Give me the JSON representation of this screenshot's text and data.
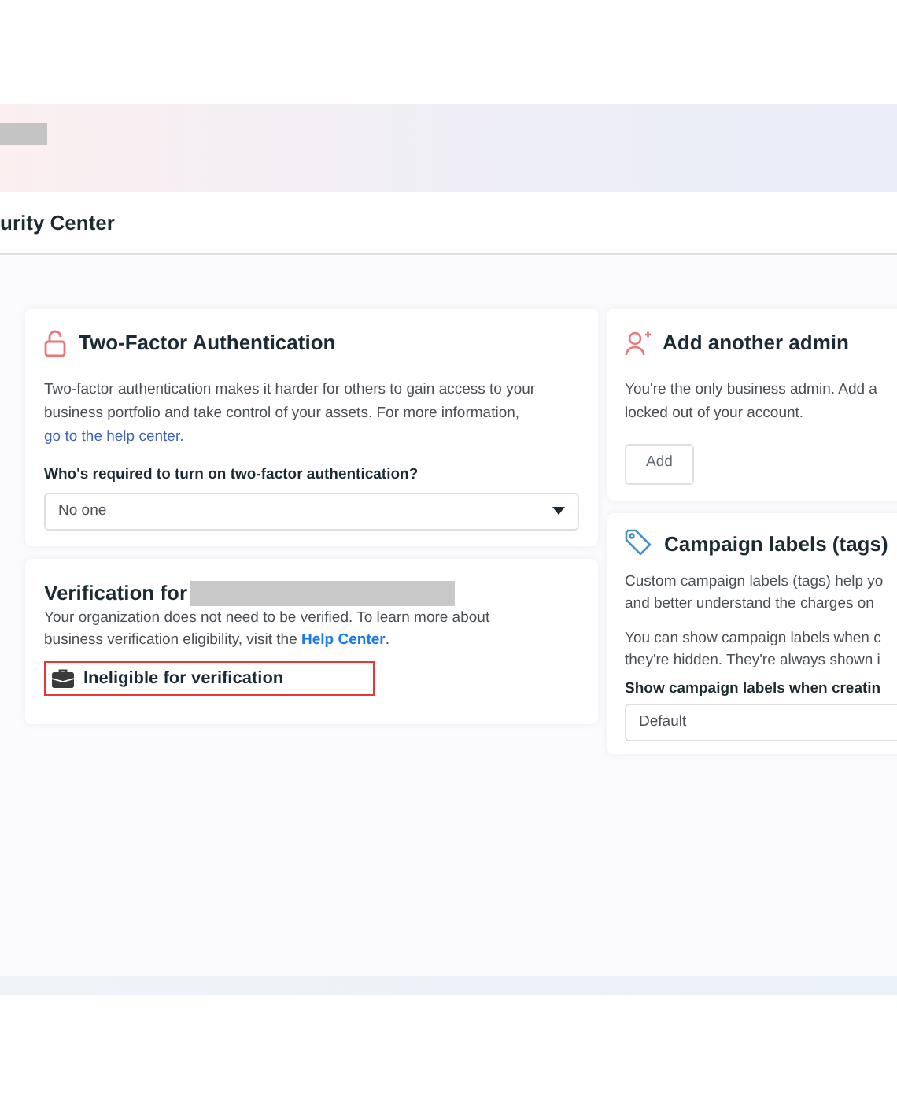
{
  "header": {
    "title": "urity Center"
  },
  "two_factor": {
    "title": "Two-Factor Authentication",
    "description": "Two-factor authentication makes it harder for others to gain access to your business portfolio and take control of your assets. For more information, ",
    "link": "go to the help center.",
    "question": "Who's required to turn on two-factor authentication?",
    "dropdown_value": "No one"
  },
  "verification": {
    "title": "Verification for",
    "description": "Your organization does not need to be verified. To learn more about business verification eligibility, visit the ",
    "link": "Help Center",
    "after_link": ".",
    "status": "Ineligible for verification"
  },
  "add_admin": {
    "title": "Add another admin",
    "lines": [
      "You're the only business admin. Add a",
      "locked out of your account."
    ],
    "button": "Add"
  },
  "campaign_labels": {
    "title": "Campaign labels (tags)",
    "paragraphs": [
      [
        "Custom campaign labels (tags) help yo",
        "and better understand the charges on"
      ],
      [
        "You can show campaign labels when c",
        "they're hidden. They're always shown i"
      ]
    ],
    "question": "Show campaign labels when creatin",
    "dropdown_value": "Default"
  }
}
